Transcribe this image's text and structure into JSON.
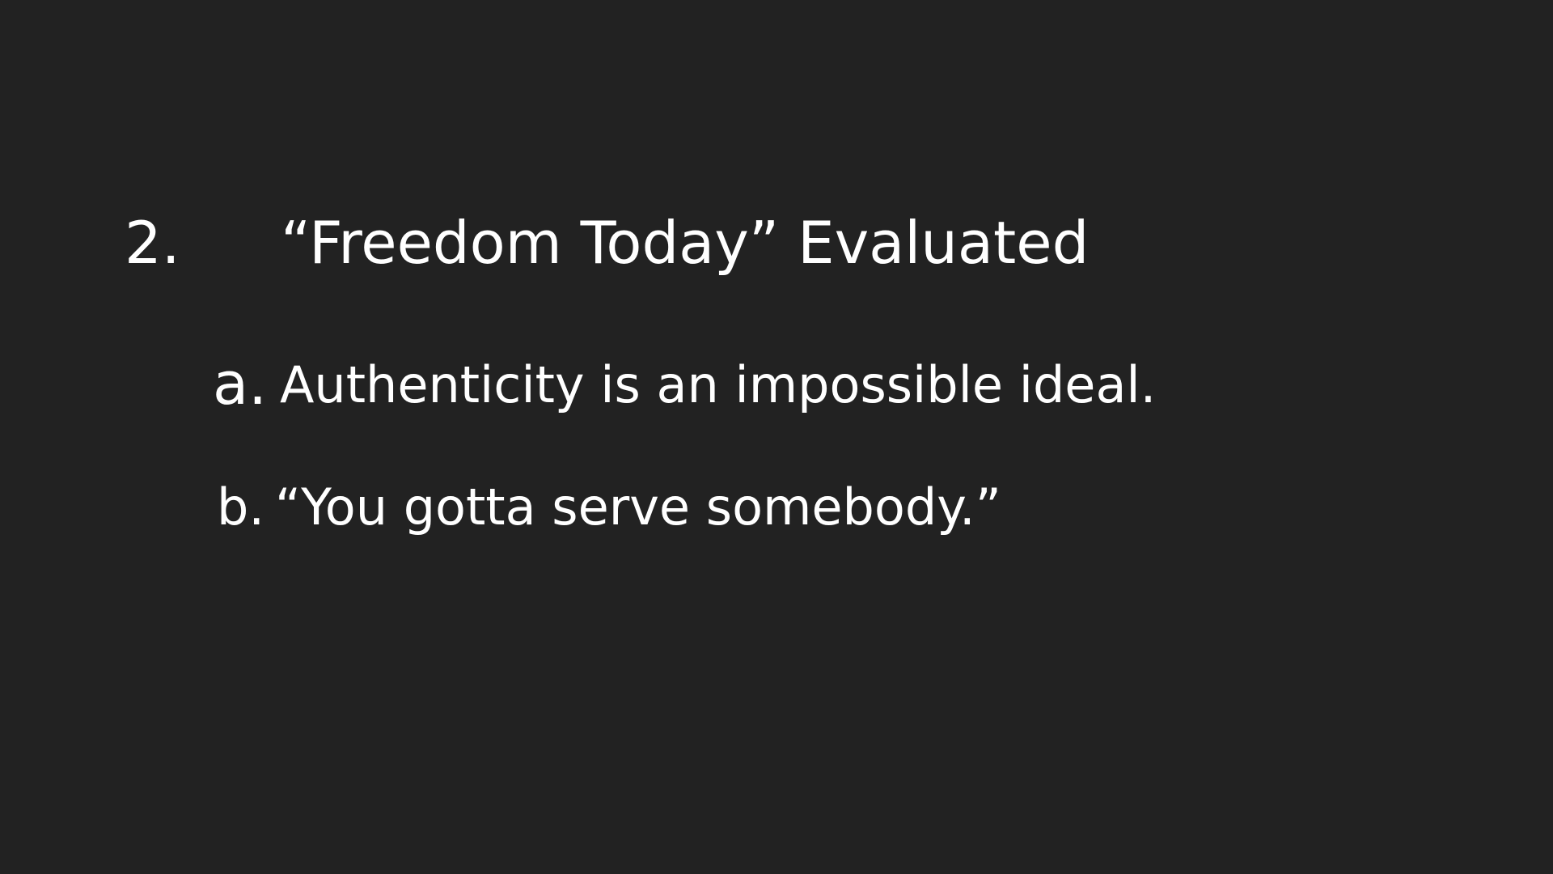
{
  "heading": {
    "number": "2.",
    "title": "“Freedom Today” Evaluated"
  },
  "points": [
    {
      "marker": "a.",
      "text": "Authenticity is an impossible ideal."
    },
    {
      "marker": "b.",
      "text": "“You gotta serve somebody.”"
    }
  ],
  "colors": {
    "background": "#222222",
    "text": "#ffffff"
  }
}
